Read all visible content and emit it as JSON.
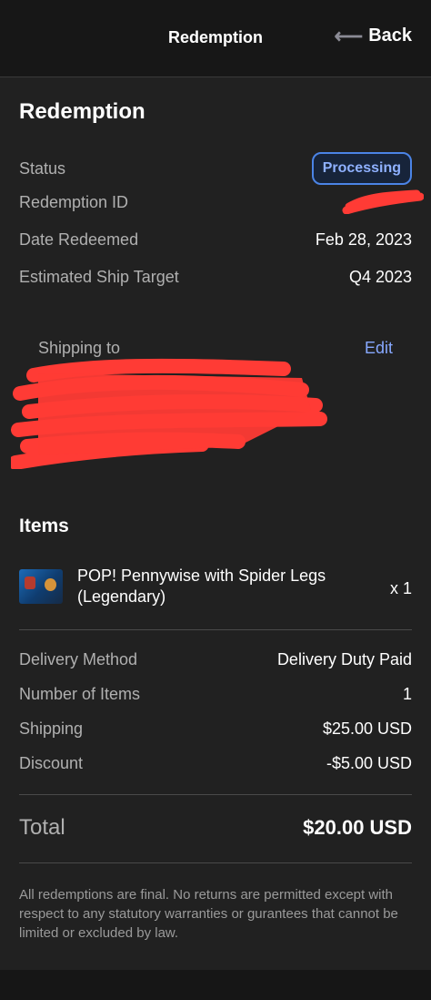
{
  "header": {
    "title": "Redemption",
    "back_label": "Back"
  },
  "summary": {
    "title": "Redemption",
    "rows": [
      {
        "label": "Status",
        "value": "Processing"
      },
      {
        "label": "Redemption ID",
        "value": ""
      },
      {
        "label": "Date Redeemed",
        "value": "Feb 28, 2023"
      },
      {
        "label": "Estimated Ship Target",
        "value": "Q4 2023"
      }
    ]
  },
  "shipping": {
    "label": "Shipping to",
    "edit_label": "Edit"
  },
  "items": {
    "title": "Items",
    "list": [
      {
        "name": "POP! Pennywise with Spider Legs (Legendary)",
        "qty": "x 1"
      }
    ]
  },
  "details": [
    {
      "label": "Delivery Method",
      "value": "Delivery Duty Paid"
    },
    {
      "label": "Number of Items",
      "value": "1"
    },
    {
      "label": "Shipping",
      "value": "$25.00 USD"
    },
    {
      "label": "Discount",
      "value": "-$5.00 USD"
    }
  ],
  "total": {
    "label": "Total",
    "value": "$20.00 USD"
  },
  "disclaimer": "All redemptions are final. No returns are permitted except with respect to any statutory warranties or gurantees that cannot be limited or excluded by law.",
  "colors": {
    "page_bg": "#161616",
    "card_bg": "#212121",
    "badge_border": "#4b84e6",
    "link": "#87a8ff",
    "redaction": "#ff3b35"
  },
  "icons": {
    "back": "left-arrow-icon"
  }
}
